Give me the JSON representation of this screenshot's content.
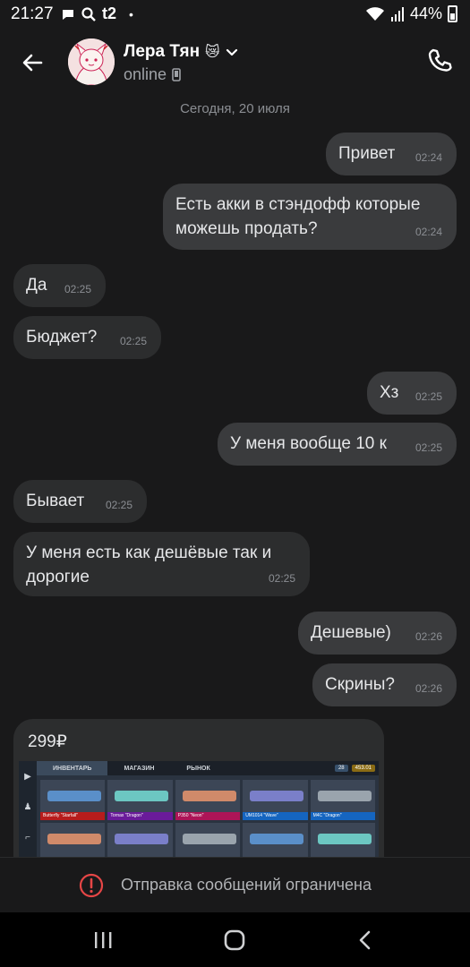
{
  "status_bar": {
    "time": "21:27",
    "carrier": "t2",
    "battery": "44%",
    "battery_level": 0.44,
    "icons": [
      "message-icon",
      "search-icon",
      "wifi-icon",
      "signal-icon",
      "battery-icon"
    ]
  },
  "header": {
    "contact_name": "Лера Тян",
    "contact_emoji": "😿",
    "status": "online"
  },
  "date_divider": "Сегодня, 20 июля",
  "messages": [
    {
      "dir": "out",
      "text": "Привет",
      "time": "02:24"
    },
    {
      "dir": "out",
      "text": "Есть акки в стэндофф которые\nможешь продать?",
      "time": "02:24"
    },
    {
      "dir": "in",
      "text": "Да",
      "time": "02:25"
    },
    {
      "dir": "in",
      "text": "Бюджет?",
      "time": "02:25"
    },
    {
      "dir": "out",
      "text": "Хз",
      "time": "02:25"
    },
    {
      "dir": "out",
      "text": "У меня вообще 10 к",
      "time": "02:25"
    },
    {
      "dir": "in",
      "text": "Бывает",
      "time": "02:25"
    },
    {
      "dir": "in",
      "text": "У меня есть как дешёвые так и\nдорогие",
      "time": "02:25"
    },
    {
      "dir": "out",
      "text": "Дешевые)",
      "time": "02:26"
    },
    {
      "dir": "out",
      "text": "Скрины?",
      "time": "02:26"
    }
  ],
  "photo_message": {
    "caption": "299₽",
    "screenshot": {
      "tabs": [
        "ИНВЕНТАРЬ",
        "МАГАЗИН",
        "РЫНОК"
      ],
      "balance_silver": "28",
      "balance_gold": "453.01",
      "items": [
        {
          "name": "Butterfly \"Starfall\"",
          "color": "#b71c1c"
        },
        {
          "name": "Tornax \"Dragon\"",
          "color": "#6a1b9a"
        },
        {
          "name": "P350 \"Neon\"",
          "color": "#ad1457"
        },
        {
          "name": "UM1014 \"Wave\"",
          "color": "#1565c0"
        },
        {
          "name": "M4C \"Dragon\"",
          "color": "#1565c0"
        }
      ]
    }
  },
  "restriction_notice": "Отправка сообщений ограничена",
  "colors": {
    "background": "#19191a",
    "bubble_out": "#3a3b3d",
    "bubble_in": "#2c2d2e",
    "alert": "#e64646"
  }
}
